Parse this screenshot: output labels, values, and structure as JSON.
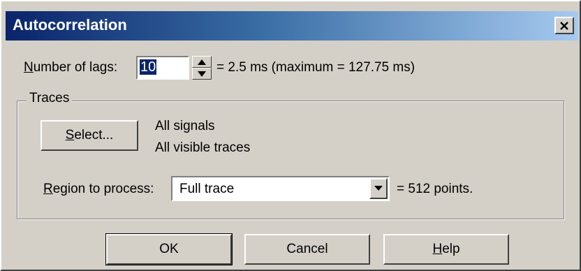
{
  "window": {
    "title": "Autocorrelation",
    "close_glyph": "✕"
  },
  "lags": {
    "label_accel": "N",
    "label_rest": "umber of lags:",
    "value": "10",
    "summary": "= 2.5 ms (maximum = 127.75 ms)"
  },
  "traces": {
    "group_title": "Traces",
    "select_accel": "S",
    "select_rest": "elect...",
    "signals_text": "All signals",
    "traces_text": "All visible traces"
  },
  "region": {
    "label_accel": "R",
    "label_rest": "egion to process:",
    "selected": "Full trace",
    "points_text": "= 512 points."
  },
  "buttons": {
    "ok": "OK",
    "cancel": "Cancel",
    "help_accel": "H",
    "help_rest": "elp"
  },
  "icons": {
    "close": "close-icon",
    "spin_up": "triangle-up-icon",
    "spin_down": "triangle-down-icon",
    "dropdown": "chevron-down-icon"
  },
  "colors": {
    "title_gradient_start": "#0a246a",
    "title_gradient_end": "#a6caf0",
    "dialog_face": "#d4d0c8",
    "selection": "#0a246a"
  }
}
